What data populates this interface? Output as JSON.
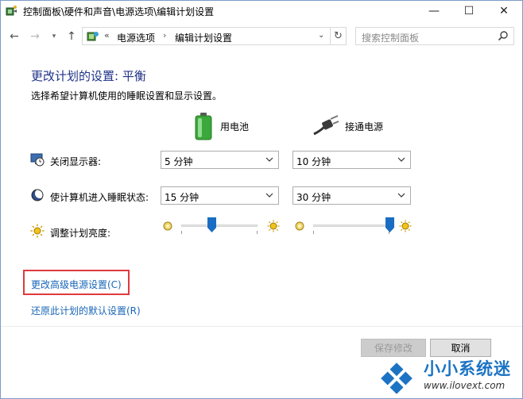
{
  "window": {
    "title": "控制面板\\硬件和声音\\电源选项\\编辑计划设置",
    "minimize_glyph": "—",
    "maximize_glyph": "☐",
    "close_glyph": "✕"
  },
  "nav": {
    "back_glyph": "←",
    "forward_glyph": "→",
    "history_glyph": "▾",
    "up_glyph": "↑",
    "breadcrumb_lead": "«",
    "breadcrumbs": [
      "电源选项",
      "编辑计划设置"
    ],
    "breadcrumb_separator": "›",
    "address_dropdown_glyph": "⌄",
    "refresh_glyph": "↻",
    "search_placeholder": "搜索控制面板"
  },
  "content": {
    "heading": "更改计划的设置: 平衡",
    "subheading": "选择希望计算机使用的睡眠设置和显示设置。",
    "columns": {
      "battery_label": "用电池",
      "plugged_label": "接通电源"
    },
    "settings": [
      {
        "label": "关闭显示器:",
        "icon": "monitor-clock-icon",
        "battery": "5 分钟",
        "plugged": "10 分钟"
      },
      {
        "label": "使计算机进入睡眠状态:",
        "icon": "moon-icon",
        "battery": "15 分钟",
        "plugged": "30 分钟"
      }
    ],
    "brightness": {
      "label": "调整计划亮度:",
      "icon": "sun-icon",
      "battery_level": 0.4,
      "plugged_level": 1.0
    },
    "links": {
      "advanced": "更改高级电源设置(C)",
      "restore": "还原此计划的默认设置(R)"
    }
  },
  "footer": {
    "save_label": "保存修改",
    "cancel_label": "取消"
  },
  "watermark": {
    "title": "小小系统迷",
    "url": "www.ilovext.com"
  },
  "colors": {
    "heading": "#1e3287",
    "link": "#1866b8",
    "highlight": "#e0393e",
    "slider_thumb": "#1a6dc2",
    "watermark": "#1c73c4"
  }
}
